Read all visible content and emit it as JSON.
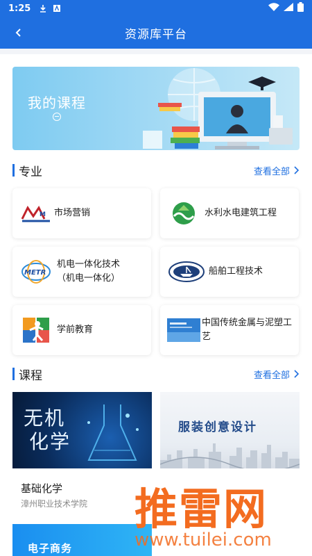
{
  "status_bar": {
    "time": "1:25"
  },
  "app_bar": {
    "title": "资源库平台"
  },
  "banner": {
    "title": "我的课程"
  },
  "majors": {
    "title": "专业",
    "more": "查看全部",
    "items": [
      {
        "label": "市场营销",
        "logo_text": "M"
      },
      {
        "label": "水利水电建筑工程"
      },
      {
        "label": "机电一体化技术（机电一体化）",
        "logo_text": "METR"
      },
      {
        "label": "船舶工程技术"
      },
      {
        "label": "学前教育"
      },
      {
        "label": "中国传统金属与泥塑工艺"
      }
    ]
  },
  "courses": {
    "title": "课程",
    "more": "查看全部",
    "items": [
      {
        "cover_line1": "无机",
        "cover_line2": "化学",
        "name": "基础化学",
        "school": "漳州职业技术学院"
      },
      {
        "cover_text": "服装创意设计"
      },
      {
        "cover_text": "电子商务"
      }
    ]
  },
  "watermark": {
    "title": "推雷网",
    "url": "www.tuilei.com"
  },
  "colors": {
    "primary": "#1f6fe0",
    "watermark": "#f36c20"
  }
}
